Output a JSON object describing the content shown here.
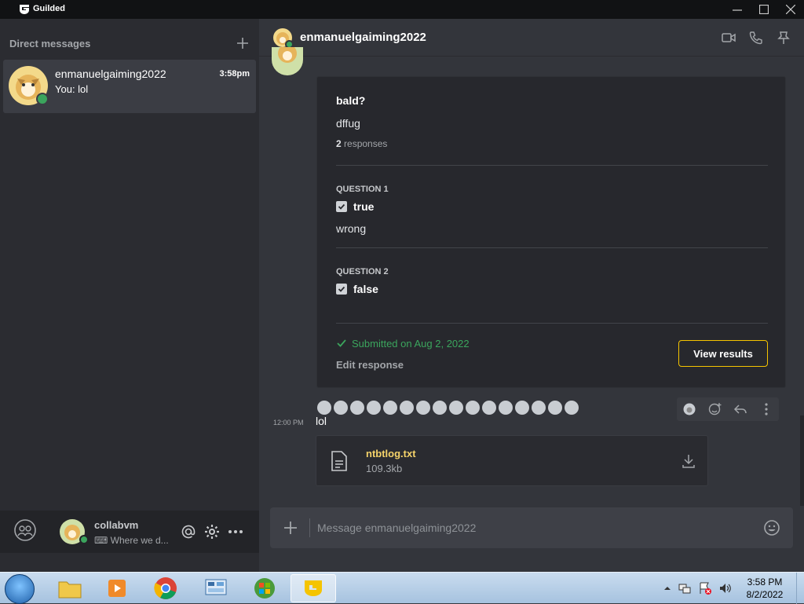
{
  "window": {
    "app_name": "Guilded"
  },
  "sidebar": {
    "header": "Direct messages",
    "dm": {
      "name": "enmanuelgaiming2022",
      "time": "3:58pm",
      "preview": "You: lol"
    },
    "user": {
      "name": "collabvm",
      "status": "⌨ Where we d..."
    }
  },
  "chat": {
    "title": "enmanuelgaiming2022",
    "form": {
      "title": "bald?",
      "description": "dffug",
      "response_count": "2",
      "response_label": "responses",
      "questions": [
        {
          "label": "QUESTION 1",
          "answer": "true",
          "extra": "wrong"
        },
        {
          "label": "QUESTION 2",
          "answer": "false"
        }
      ],
      "submitted": "Submitted on Aug 2, 2022",
      "edit": "Edit response",
      "view_results": "View results"
    },
    "reaction_count": 16,
    "message": {
      "time": "12:00 PM",
      "text": "lol"
    },
    "attachment": {
      "name": "ntbtlog.txt",
      "size": "109.3kb"
    },
    "composer_placeholder": "Message enmanuelgaiming2022"
  },
  "taskbar": {
    "time": "3:58 PM",
    "date": "8/2/2022"
  },
  "colors": {
    "accent": "#f5c400",
    "online": "#3ba55d",
    "success": "#3ba55d",
    "attachment": "#f5d36a"
  }
}
